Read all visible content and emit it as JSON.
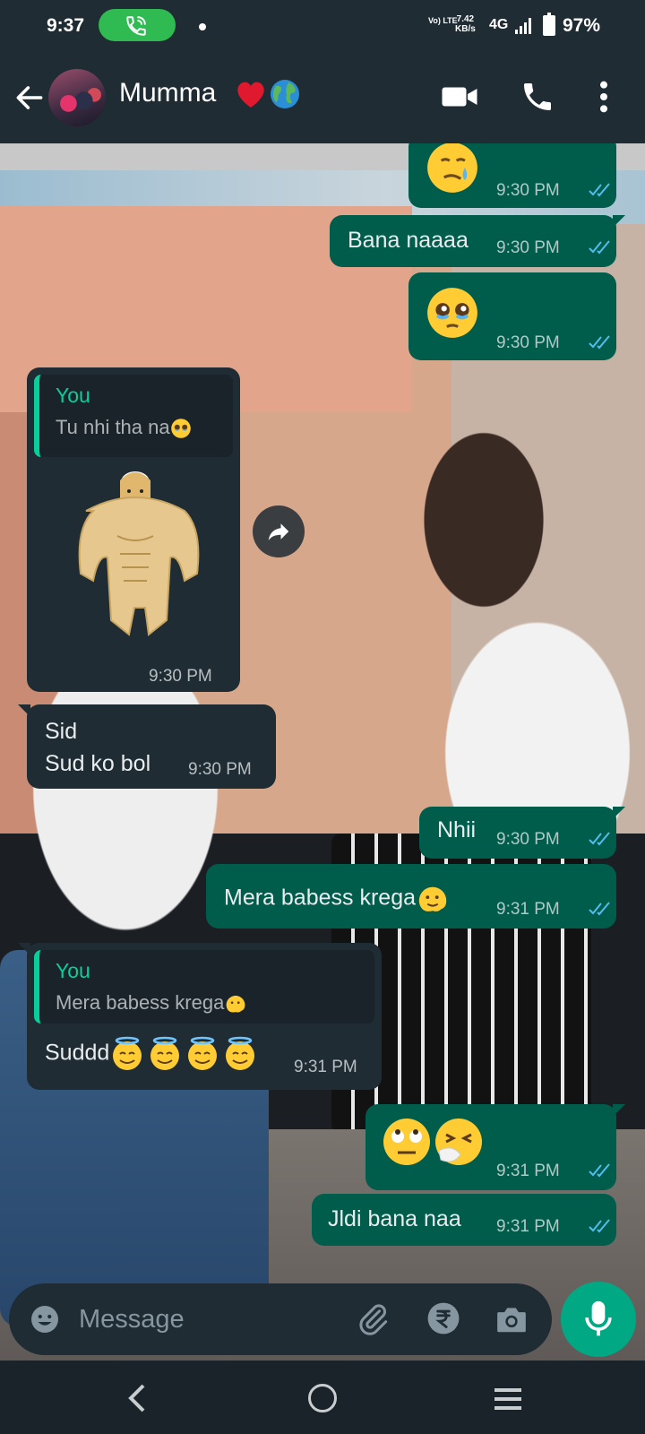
{
  "status_bar": {
    "time": "9:37",
    "volte": "Vo) LTE",
    "net_speed_value": "7.42",
    "net_speed_unit": "KB/s",
    "network": "4G",
    "battery": "97%"
  },
  "header": {
    "contact_name": "Mumma",
    "contact_emoji": [
      "red-heart",
      "globe-emoji"
    ]
  },
  "messages": [
    {
      "dir": "out",
      "text": "",
      "emoji": [
        "face-holding-back-tears"
      ],
      "time": "9:30 PM",
      "read": true
    },
    {
      "dir": "out",
      "text": "Bana naaaa",
      "time": "9:30 PM",
      "read": true
    },
    {
      "dir": "out",
      "text": "",
      "emoji": [
        "pleading-tears-face"
      ],
      "time": "9:30 PM",
      "read": true
    },
    {
      "dir": "in",
      "reply_to": {
        "author": "You",
        "text": "Tu nhi tha na"
      },
      "sticker": "buff-doge",
      "time": "9:30 PM"
    },
    {
      "dir": "in",
      "text": "Sid\nSud ko bol",
      "time": "9:30 PM"
    },
    {
      "dir": "out",
      "text": "Nhii",
      "time": "9:30 PM",
      "read": true
    },
    {
      "dir": "out",
      "text": "Mera babess krega",
      "time": "9:31 PM",
      "read": true
    },
    {
      "dir": "in",
      "reply_to": {
        "author": "You",
        "text": "Mera babess krega"
      },
      "text": "Suddd",
      "time": "9:31 PM"
    },
    {
      "dir": "out",
      "text": "",
      "emoji": [
        "face-rolling-eyes",
        "sneezing-face"
      ],
      "time": "9:31 PM",
      "read": true
    },
    {
      "dir": "out",
      "text": "Jldi bana naa",
      "time": "9:31 PM",
      "read": true
    }
  ],
  "composer": {
    "placeholder": "Message"
  },
  "colors": {
    "bar_bg": "#1f2c34",
    "outgoing_bubble": "#005c4b",
    "incoming_bubble": "#1f2c34",
    "accent": "#00a884",
    "read_ticks": "#53bdeb",
    "call_pill": "#2fbb52"
  }
}
